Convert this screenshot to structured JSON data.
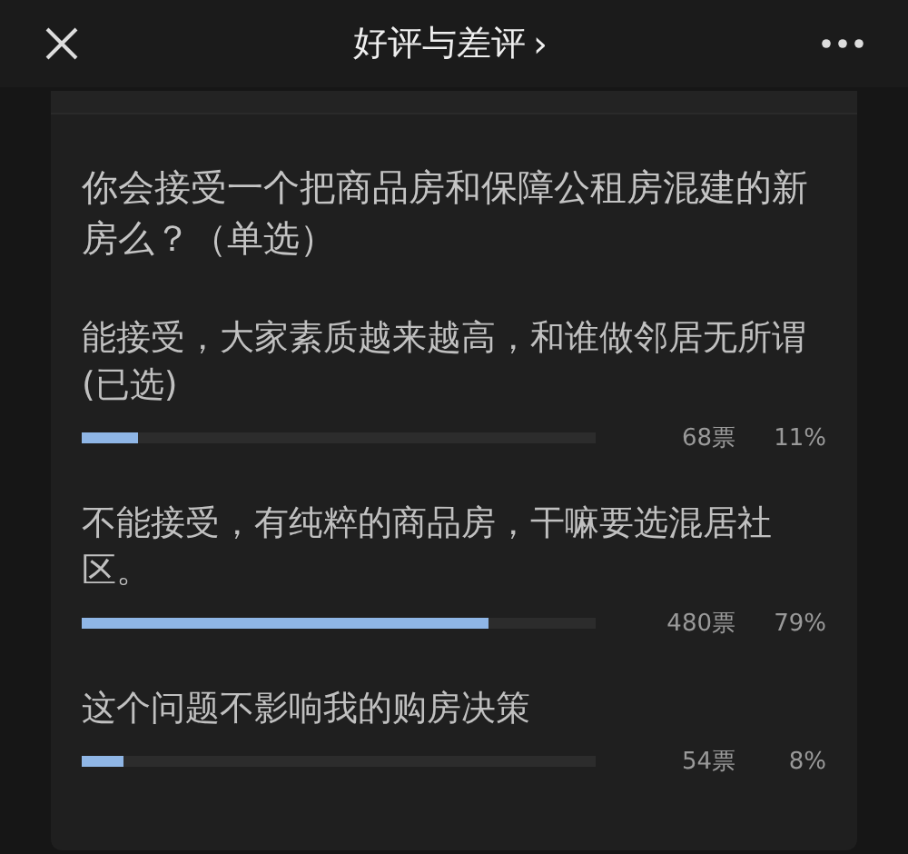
{
  "header": {
    "title": "好评与差评",
    "title_arrow": "›"
  },
  "poll": {
    "question": "你会接受一个把商品房和保障公租房混建的新房么？（单选）",
    "options": [
      {
        "text": "能接受，大家素质越来越高，和谁做邻居无所谓(已选)",
        "level": 0.11,
        "votes": "68票",
        "percent": "11%"
      },
      {
        "text": "不能接受，有纯粹的商品房，干嘛要选混居社区。",
        "level": 0.79,
        "votes": "480票",
        "percent": "79%"
      },
      {
        "text": "这个问题不影响我的购房决策",
        "level": 0.08,
        "votes": "54票",
        "percent": "8%"
      }
    ]
  }
}
